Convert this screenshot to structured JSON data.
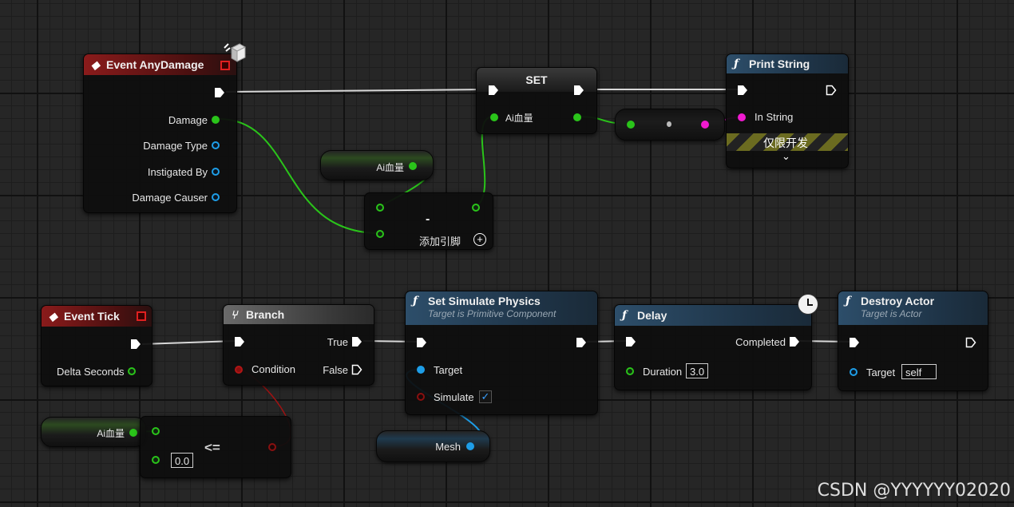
{
  "event_any_damage": {
    "title": "Event AnyDamage",
    "pins": [
      "Damage",
      "Damage Type",
      "Instigated By",
      "Damage Causer"
    ]
  },
  "set_node": {
    "title": "SET",
    "pin": "Ai血量"
  },
  "print_string": {
    "title": "Print String",
    "pin": "In String",
    "dev_only": "仅限开发"
  },
  "get_ai_top": {
    "label": "Ai血量"
  },
  "subtract": {
    "symbol": "-",
    "add_pin": "添加引脚"
  },
  "event_tick": {
    "title": "Event Tick",
    "pin": "Delta Seconds"
  },
  "branch": {
    "title": "Branch",
    "condition": "Condition",
    "true_label": "True",
    "false_label": "False"
  },
  "set_sim": {
    "title": "Set Simulate Physics",
    "subtitle": "Target is Primitive Component",
    "target": "Target",
    "simulate": "Simulate",
    "simulate_checked": true
  },
  "delay": {
    "title": "Delay",
    "completed": "Completed",
    "duration_label": "Duration",
    "duration_value": "3.0"
  },
  "destroy": {
    "title": "Destroy Actor",
    "subtitle": "Target is Actor",
    "target": "Target",
    "target_value": "self"
  },
  "get_ai_bottom": {
    "label": "Ai血量"
  },
  "compare": {
    "symbol": "<=",
    "value": "0.0"
  },
  "mesh": {
    "label": "Mesh"
  },
  "watermark": "CSDN @YYYYYY02020",
  "colors": {
    "float": "#2ac41a",
    "object": "#1e9ee8",
    "string": "#f01ad0",
    "bool": "#b01515",
    "exec": "#ffffff"
  },
  "icons": [
    "event-diamond-icon",
    "function-icon",
    "branch-icon",
    "clock-icon",
    "gear-cube-icon",
    "chevron-down-icon",
    "add-pin-icon",
    "checkmark-icon"
  ]
}
